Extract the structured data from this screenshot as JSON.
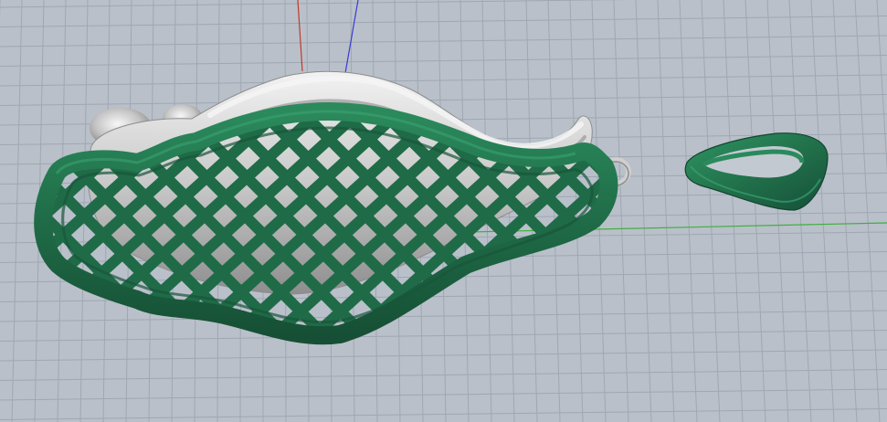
{
  "viewport": {
    "view": "perspective",
    "grid": true,
    "axes": {
      "x_color": "#3fae3f",
      "y_color": "#3a3ad6",
      "z_color": "#c0392b"
    },
    "background_color": "#b9c0c9",
    "grid_color": "#9ea7b3"
  },
  "objects": [
    {
      "name": "wing-pendant-lattice-back",
      "material_color": "#1f6b47"
    },
    {
      "name": "wing-pendant-sculpted-body",
      "material_color": "#d6d6d6"
    },
    {
      "name": "wing-pendant-bail-loop",
      "material_color": "#d6d6d6"
    },
    {
      "name": "bail-ring",
      "material_color": "#1f6b47"
    }
  ]
}
